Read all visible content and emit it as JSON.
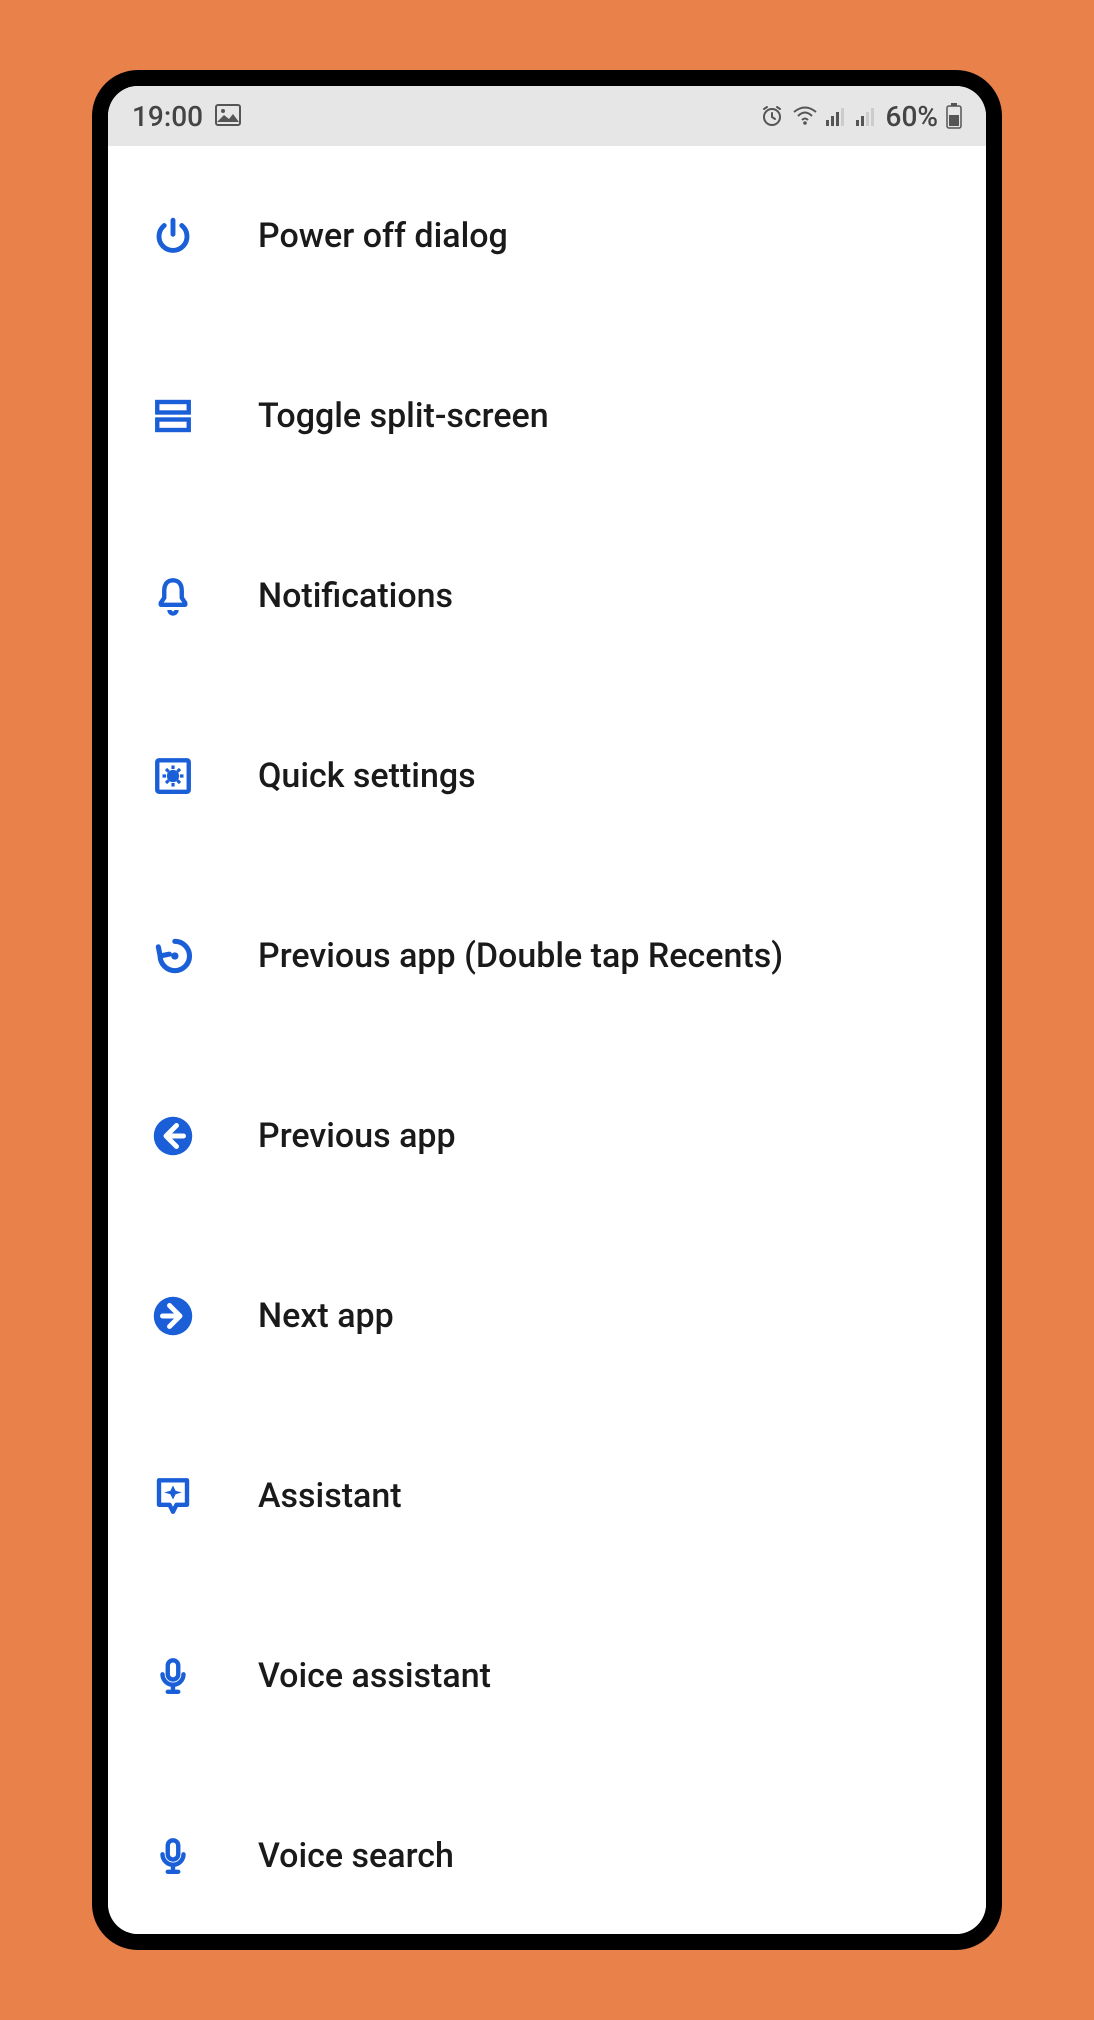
{
  "status": {
    "time": "19:00",
    "battery_pct": "60%"
  },
  "menu": {
    "items": [
      {
        "label": "Power off dialog"
      },
      {
        "label": "Toggle split-screen"
      },
      {
        "label": "Notifications"
      },
      {
        "label": "Quick settings"
      },
      {
        "label": "Previous app (Double tap Recents)"
      },
      {
        "label": "Previous app"
      },
      {
        "label": "Next app"
      },
      {
        "label": "Assistant"
      },
      {
        "label": "Voice assistant"
      },
      {
        "label": "Voice search"
      }
    ]
  },
  "colors": {
    "accent": "#1a5fd8",
    "bg_outer": "#e8814a"
  }
}
